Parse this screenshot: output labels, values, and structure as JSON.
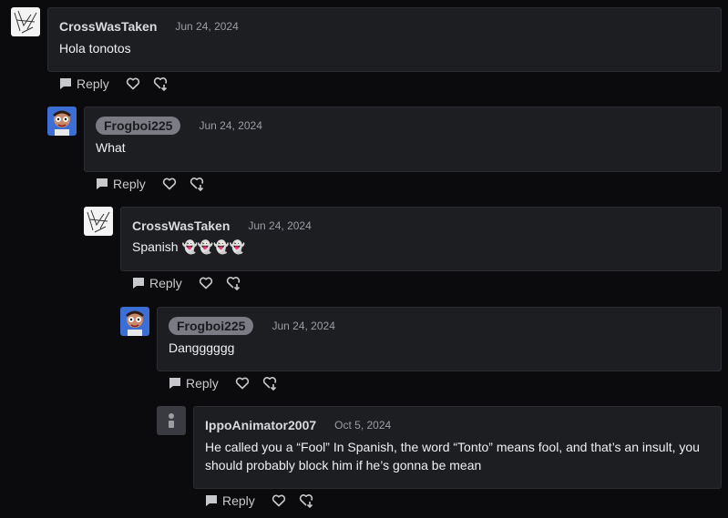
{
  "actions": {
    "reply_label": "Reply"
  },
  "comments": [
    {
      "author": "CrossWasTaken",
      "date": "Jun 24, 2024",
      "text": "Hola tonotos",
      "avatar": "sketch-avatar"
    },
    {
      "author": "Frogboi225",
      "date": "Jun 24, 2024",
      "text": "What",
      "avatar": "frog-avatar"
    },
    {
      "author": "CrossWasTaken",
      "date": "Jun 24, 2024",
      "text": "Spanish 👻👻👻👻",
      "avatar": "sketch-avatar"
    },
    {
      "author": "Frogboi225",
      "date": "Jun 24, 2024",
      "text": "Dangggggg",
      "avatar": "frog-avatar"
    },
    {
      "author": "IppoAnimator2007",
      "date": "Oct 5, 2024",
      "text": "He called you a “Fool” In Spanish, the word “Tonto” means fool, and that’s an insult, you should probably block him if he’s gonna be mean",
      "avatar": "default-avatar"
    }
  ]
}
